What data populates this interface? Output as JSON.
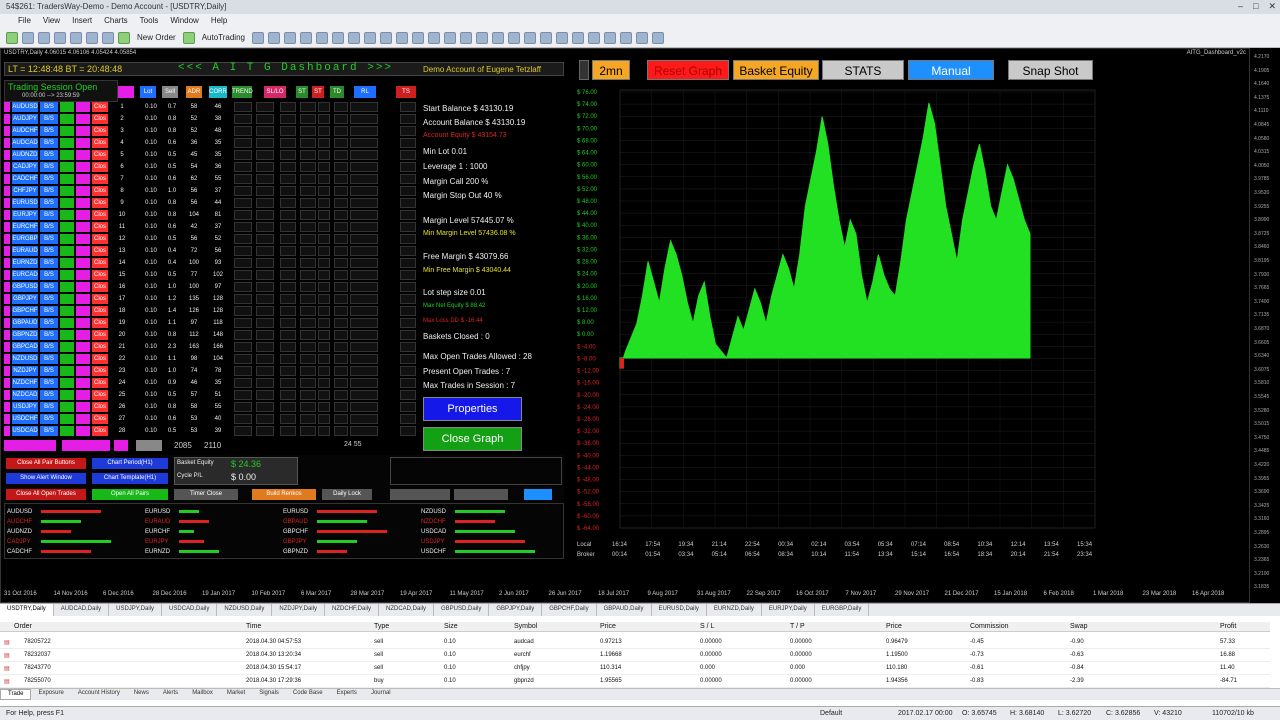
{
  "window": {
    "title": "54$261: TradersWay-Demo - Demo Account - [USDTRY,Daily]"
  },
  "menu": [
    "File",
    "View",
    "Insert",
    "Charts",
    "Tools",
    "Window",
    "Help"
  ],
  "toolbar": {
    "new_order": "New Order",
    "autotrading": "AutoTrading"
  },
  "chart_info": "USDTRY,Daily 4.06015 4.06106 4.05424 4.05854",
  "dashboard": {
    "time": "LT = 12:48:48   BT = 20:48:48",
    "title": "<<< A I T G   Dashboard >>>",
    "account_name": "Demo Account of  Eugene Tetzlaff",
    "session": "Trading Session Open",
    "session_time": "00:00:00 --> 23:59:59",
    "header_btns": [
      "Lot",
      "Sell",
      "ADR",
      "CORR",
      "TREND",
      "SL/LO",
      "ST",
      "TD",
      "RL",
      "TS"
    ],
    "chart_name": "AITG_Dashboard_v2c"
  },
  "pairs": [
    "AUDUSD",
    "AUDJPY",
    "AUDCHF",
    "AUDCAD",
    "AUDNZD",
    "CADJPY",
    "CADCHF",
    "CHFJPY",
    "EURUSD",
    "EURJPY",
    "EURCHF",
    "EURGBP",
    "EURAUD",
    "EURNZD",
    "EURCAD",
    "GBPUSD",
    "GBPJPY",
    "GBPCHF",
    "GBPAUD",
    "GBPNZD",
    "GBPCAD",
    "NZDUSD",
    "NZDJPY",
    "NZDCHF",
    "NZDCAD",
    "USDJPY",
    "USDCHF",
    "USDCAD"
  ],
  "grid_cols": {
    "bs": "B/S",
    "cls": "Clos",
    "lot": "0.10"
  },
  "grid_rows": [
    {
      "n": "1",
      "v1": "0.7",
      "v2": "58",
      "v3": "46"
    },
    {
      "n": "2",
      "v1": "0.8",
      "v2": "52",
      "v3": "38"
    },
    {
      "n": "3",
      "v1": "0.8",
      "v2": "52",
      "v3": "48"
    },
    {
      "n": "4",
      "v1": "0.6",
      "v2": "36",
      "v3": "35"
    },
    {
      "n": "5",
      "v1": "0.5",
      "v2": "45",
      "v3": "35"
    },
    {
      "n": "6",
      "v1": "0.5",
      "v2": "54",
      "v3": "36"
    },
    {
      "n": "7",
      "v1": "0.6",
      "v2": "62",
      "v3": "55"
    },
    {
      "n": "8",
      "v1": "1.0",
      "v2": "56",
      "v3": "37"
    },
    {
      "n": "9",
      "v1": "0.8",
      "v2": "56",
      "v3": "44"
    },
    {
      "n": "10",
      "v1": "0.8",
      "v2": "104",
      "v3": "81"
    },
    {
      "n": "11",
      "v1": "0.6",
      "v2": "42",
      "v3": "37"
    },
    {
      "n": "12",
      "v1": "0.5",
      "v2": "56",
      "v3": "52"
    },
    {
      "n": "13",
      "v1": "0.4",
      "v2": "72",
      "v3": "56"
    },
    {
      "n": "14",
      "v1": "0.4",
      "v2": "100",
      "v3": "93"
    },
    {
      "n": "15",
      "v1": "0.5",
      "v2": "77",
      "v3": "102"
    },
    {
      "n": "16",
      "v1": "1.0",
      "v2": "100",
      "v3": "97"
    },
    {
      "n": "17",
      "v1": "1.2",
      "v2": "135",
      "v3": "128"
    },
    {
      "n": "18",
      "v1": "1.4",
      "v2": "126",
      "v3": "128"
    },
    {
      "n": "19",
      "v1": "1.1",
      "v2": "97",
      "v3": "118"
    },
    {
      "n": "20",
      "v1": "0.8",
      "v2": "112",
      "v3": "148"
    },
    {
      "n": "21",
      "v1": "2.3",
      "v2": "163",
      "v3": "166"
    },
    {
      "n": "22",
      "v1": "1.1",
      "v2": "98",
      "v3": "104"
    },
    {
      "n": "23",
      "v1": "1.0",
      "v2": "74",
      "v3": "78"
    },
    {
      "n": "24",
      "v1": "0.9",
      "v2": "46",
      "v3": "35"
    },
    {
      "n": "25",
      "v1": "0.5",
      "v2": "57",
      "v3": "51"
    },
    {
      "n": "26",
      "v1": "0.8",
      "v2": "58",
      "v3": "55"
    },
    {
      "n": "27",
      "v1": "0.6",
      "v2": "53",
      "v3": "40"
    },
    {
      "n": "28",
      "v1": "0.5",
      "v2": "53",
      "v3": "39"
    }
  ],
  "grid_footer": {
    "total": "2085",
    "total2": "2110",
    "right": "24  55"
  },
  "stats": {
    "start_balance": "Start Balance   $ 43130.19",
    "account_balance": "Account Balance   $ 43130.19",
    "account_equity": "Account Equity   $ 43154.73",
    "min_lot": "Min Lot   0.01",
    "leverage": "Leverage   1 : 1000",
    "margin_call": "Margin Call   200 %",
    "margin_stop_out": "Margin Stop Out   40 %",
    "margin_level": "Margin Level   57445.07 %",
    "min_margin_level": "Min Margin Level   57436.08 %",
    "free_margin": "Free Margin   $ 43079.66",
    "min_free_margin": "Min Free Margin   $ 43040.44",
    "lot_step": "Lot step size   0.01",
    "max_net_equity": "Max Net Equity   $ 88.42",
    "max_loss": "Max Loss DD   $ -16.44",
    "baskets_closed": "Baskets Closed :  0",
    "max_open_trades": "Max Open Trades Allowed : 28",
    "present_open": "Present Open Trades  :  7",
    "max_trades_session": "Max Trades in Session :  7"
  },
  "buttons": {
    "properties": "Properties",
    "close_graph": "Close Graph",
    "tf": "2mn",
    "reset_graph": "Reset Graph",
    "basket_equity": "Basket Equity",
    "stats": "STATS",
    "manual": "Manual",
    "snapshot": "Snap Shot"
  },
  "control": {
    "close_all_pair": "Close All Pair Buttons",
    "chart_period": "Chart Period(H1)",
    "show_alert": "Show Alert Window",
    "chart_template": "Chart Template(H1)",
    "close_all_open": "Close All Open Trades",
    "open_all": "Open All Pairs",
    "basket_equity": "Basket Equity",
    "basket_equity_val": "$ 24.36",
    "cycle_pl": "Cycle P/L",
    "cycle_pl_val": "$ 0.00",
    "build_renkos": "Build Renkos",
    "auto_lock": "Daily Lock",
    "timer_close": "Timer Close"
  },
  "strength": {
    "col1": [
      "AUDUSD",
      "AUDCHF",
      "AUDNZD",
      "CADJPY",
      "CADCHF"
    ],
    "col2": [
      "EURUSD",
      "EURAUD",
      "EURCHF",
      "EURJPY",
      "EURNZD"
    ],
    "col3": [
      "EURUSD",
      "GBPAUD",
      "GBPCHF",
      "GBPJPY",
      "GBPNZD"
    ],
    "col4": [
      "NZDUSD",
      "NZDCHF",
      "USDCAD",
      "USDJPY",
      "USDCHF"
    ]
  },
  "chart_data": {
    "type": "area",
    "yaxis": [
      "$ 76.00",
      "$ 74.00",
      "$ 72.00",
      "$ 70.00",
      "$ 68.00",
      "$ 64.00",
      "$ 60.00",
      "$ 56.00",
      "$ 52.00",
      "$ 48.00",
      "$ 44.00",
      "$ 40.00",
      "$ 36.00",
      "$ 32.00",
      "$ 28.00",
      "$ 24.00",
      "$ 20.00",
      "$ 16.00",
      "$ 12.00",
      "$ 8.00",
      "$ 0.00",
      "$ -4.00",
      "$ -8.00",
      "$ -12.00",
      "$ -16.00",
      "$ -20.00",
      "$ -24.00",
      "$ -28.00",
      "$ -32.00",
      "$ -36.00",
      "$ -40.00",
      "$ -44.00",
      "$ -48.00",
      "$ -52.00",
      "$ -56.00",
      "$ -60.00",
      "$ -64.00"
    ],
    "local_times": [
      "16:14",
      "17:54",
      "19:34",
      "21:14",
      "22:54",
      "00:34",
      "02:14",
      "03:54",
      "05:34",
      "07:14",
      "08:54",
      "10:34",
      "12:14",
      "13:54",
      "15:34"
    ],
    "broker_times": [
      "00:14",
      "01:54",
      "03:34",
      "05:14",
      "06:54",
      "08:34",
      "10:14",
      "11:54",
      "13:34",
      "15:14",
      "16:54",
      "18:34",
      "20:14",
      "21:54",
      "23:34"
    ],
    "local_label": "Local",
    "broker_label": "Broker",
    "values": [
      -4,
      2,
      6,
      10,
      18,
      28,
      22,
      16,
      26,
      34,
      30,
      24,
      16,
      10,
      18,
      22,
      12,
      4,
      2,
      0,
      6,
      12,
      8,
      14,
      20,
      16,
      10,
      18,
      24,
      30,
      26,
      20,
      30,
      44,
      52,
      60,
      70,
      62,
      50,
      40,
      32,
      40,
      36,
      24,
      16,
      22,
      30,
      24,
      20,
      18,
      28,
      40,
      48,
      56,
      64,
      74,
      68,
      56,
      44,
      36,
      28,
      40,
      48,
      56,
      62,
      54,
      44,
      40,
      48,
      56,
      52,
      46,
      40,
      36
    ],
    "ylim": [
      -64,
      76
    ]
  },
  "dates": [
    "31 Oct 2016",
    "14 Nov 2016",
    "6 Dec 2016",
    "28 Dec 2016",
    "19 Jan 2017",
    "10 Feb 2017",
    "6 Mar 2017",
    "28 Mar 2017",
    "19 Apr 2017",
    "11 May 2017",
    "2 Jun 2017",
    "26 Jun 2017",
    "18 Jul 2017",
    "9 Aug 2017",
    "31 Aug 2017",
    "22 Sep 2017",
    "16 Oct 2017",
    "7 Nov 2017",
    "29 Nov 2017",
    "21 Dec 2017",
    "15 Jan 2018",
    "6 Feb 2018",
    "1 Mar 2018",
    "23 Mar 2018",
    "16 Apr 2018"
  ],
  "price_scale": [
    "4.2170",
    "4.1905",
    "4.1640",
    "4.1375",
    "4.1110",
    "4.0845",
    "4.0580",
    "4.0315",
    "4.0050",
    "3.9785",
    "3.9520",
    "3.9255",
    "3.8990",
    "3.8725",
    "3.8460",
    "3.8195",
    "3.7930",
    "3.7665",
    "3.7400",
    "3.7135",
    "3.6870",
    "3.6605",
    "3.6340",
    "3.6075",
    "3.5810",
    "3.5545",
    "3.5280",
    "3.5015",
    "3.4750",
    "3.4485",
    "3.4220",
    "3.3955",
    "3.3690",
    "3.3425",
    "3.3160",
    "3.2895",
    "3.2630",
    "3.2365",
    "3.2100",
    "3.1835"
  ],
  "chart_tabs": [
    "USDTRY,Daily",
    "AUDCAD,Daily",
    "USDJPY,Daily",
    "USDCAD,Daily",
    "NZDUSD,Daily",
    "NZDJPY,Daily",
    "NZDCHF,Daily",
    "NZDCAD,Daily",
    "GBPUSD,Daily",
    "GBPJPY,Daily",
    "GBPCHF,Daily",
    "GBPAUD,Daily",
    "EURUSD,Daily",
    "EURNZD,Daily",
    "EURJPY,Daily",
    "EURGBP,Daily"
  ],
  "terminal": {
    "headers": [
      "Order",
      "Time",
      "Type",
      "Size",
      "Symbol",
      "Price",
      "S / L",
      "T / P",
      "Price",
      "Commission",
      "Swap",
      "Profit"
    ],
    "rows": [
      [
        "78205722",
        "2018.04.30 04:57:53",
        "sell",
        "0.10",
        "audcad",
        "0.97213",
        "0.00000",
        "0.00000",
        "0.96479",
        "-0.45",
        "-0.90",
        "57.33"
      ],
      [
        "78232037",
        "2018.04.30 13:20:34",
        "sell",
        "0.10",
        "eurchf",
        "1.19668",
        "0.00000",
        "0.00000",
        "1.19500",
        "-0.73",
        "-0.63",
        "16.88"
      ],
      [
        "78243770",
        "2018.04.30 15:54:17",
        "sell",
        "0.10",
        "chfjpy",
        "110.314",
        "0.000",
        "0.000",
        "110.180",
        "-0.61",
        "-0.84",
        "11.40"
      ],
      [
        "78255070",
        "2018.04.30 17:29:36",
        "buy",
        "0.10",
        "gbpnzd",
        "1.95565",
        "0.00000",
        "0.00000",
        "1.94356",
        "-0.83",
        "-2.39",
        "-84.71"
      ]
    ],
    "tabs": [
      "Trade",
      "Exposure",
      "Account History",
      "News",
      "Alerts",
      "Mailbox",
      "Market",
      "Signals",
      "Code Base",
      "Experts",
      "Journal"
    ]
  },
  "status": {
    "help": "For Help, press F1",
    "profile": "Default",
    "datetime": "2017.02.17 00:00",
    "open": "O: 3.65745",
    "high": "H: 3.68140",
    "low": "L: 3.62720",
    "close": "C: 3.62856",
    "vol": "V: 43210",
    "traffic": "110702/10 kb"
  }
}
